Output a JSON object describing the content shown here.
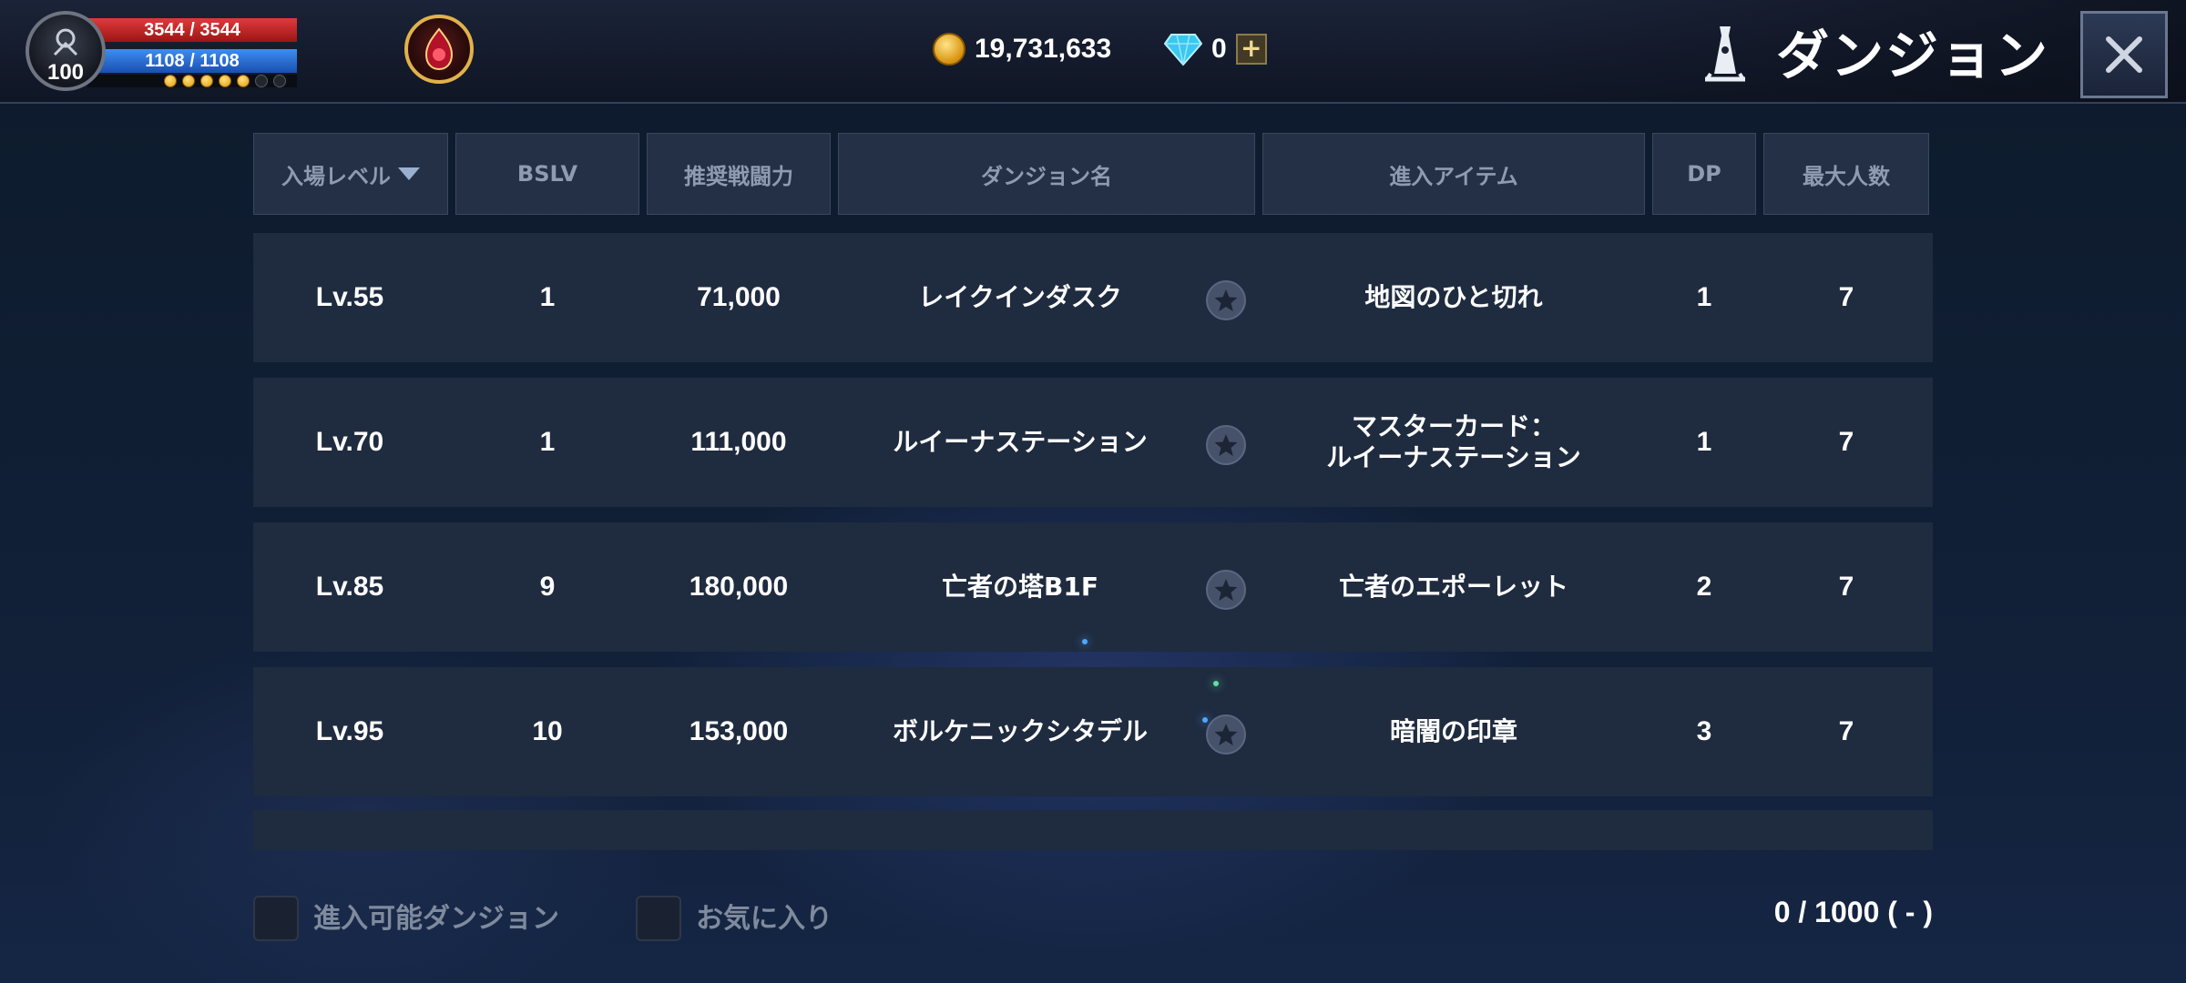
{
  "player": {
    "level": "100",
    "hp": "3544 / 3544",
    "mp": "1108 / 1108",
    "exp_dots_filled": 5,
    "exp_dots_total": 7
  },
  "currency": {
    "gold": "19,731,633",
    "gems": "0"
  },
  "header": {
    "title": "ダンジョン",
    "icons": [
      "player-emblem-icon",
      "guild-emblem-icon",
      "gold-coin-icon",
      "diamond-icon",
      "plus-icon",
      "tower-icon",
      "close-icon"
    ]
  },
  "table": {
    "columns": [
      "入場レベル",
      "BSLV",
      "推奨戦闘力",
      "ダンジョン名",
      "進入アイテム",
      "DP",
      "最大人数"
    ],
    "rows": [
      {
        "level": "Lv.55",
        "bslv": "1",
        "power": "71,000",
        "name": "レイクインダスク",
        "item": "地図のひと切れ",
        "dp": "1",
        "max": "7"
      },
      {
        "level": "Lv.70",
        "bslv": "1",
        "power": "111,000",
        "name": "ルイーナステーション",
        "item": "マスターカード：\nルイーナステーション",
        "dp": "1",
        "max": "7"
      },
      {
        "level": "Lv.85",
        "bslv": "9",
        "power": "180,000",
        "name": "亡者の塔B1F",
        "item": "亡者のエポーレット",
        "dp": "2",
        "max": "7"
      },
      {
        "level": "Lv.95",
        "bslv": "10",
        "power": "153,000",
        "name": "ボルケニックシタデル",
        "item": "暗闇の印章",
        "dp": "3",
        "max": "7"
      }
    ]
  },
  "footer": {
    "filter_enterable": "進入可能ダンジョン",
    "filter_favorites": "お気に入り",
    "counter": "0 / 1000 ( - )"
  },
  "colors": {
    "accent_gold": "#e1b24a",
    "hp": "#e13a3a",
    "mp": "#3d8ef0",
    "row_bg": "#1f2b3f"
  }
}
